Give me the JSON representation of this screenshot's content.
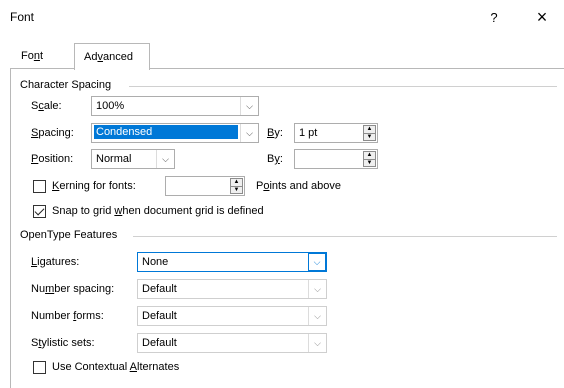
{
  "window": {
    "title": "Font",
    "help": "?",
    "close": "×"
  },
  "tabs": {
    "font": {
      "pre": "Fo",
      "ul": "n",
      "post": "t"
    },
    "advanced": {
      "pre": "Ad",
      "ul": "v",
      "post": "anced"
    }
  },
  "character_spacing": {
    "title": "Character Spacing",
    "scale": {
      "pre": "S",
      "ul": "c",
      "post": "ale:",
      "value": "100%"
    },
    "spacing": {
      "pre": "",
      "ul": "S",
      "post": "pacing:",
      "value": "Condensed"
    },
    "spacing_by": {
      "pre": "",
      "ul": "B",
      "post": "y:",
      "value": "1 pt"
    },
    "position": {
      "pre": "",
      "ul": "P",
      "post": "osition:",
      "value": "Normal"
    },
    "position_by": {
      "pre": "B",
      "ul": "y",
      "post": ":",
      "value": ""
    },
    "kerning": {
      "pre": "",
      "ul": "K",
      "post": "erning for fonts:",
      "value": "",
      "checked": false
    },
    "points_and_above": {
      "pre": "P",
      "ul": "o",
      "post": "ints and above"
    },
    "snap_to_grid": {
      "pre": "Snap to grid ",
      "ul": "w",
      "post": "hen document grid is defined",
      "checked": true
    }
  },
  "opentype": {
    "title": "OpenType Features",
    "ligatures": {
      "pre": "",
      "ul": "L",
      "post": "igatures:",
      "value": "None"
    },
    "number_spacing": {
      "pre": "Nu",
      "ul": "m",
      "post": "ber spacing:",
      "value": "Default"
    },
    "number_forms": {
      "pre": "Number ",
      "ul": "f",
      "post": "orms:",
      "value": "Default"
    },
    "stylistic_sets": {
      "pre": "S",
      "ul": "t",
      "post": "ylistic sets:",
      "value": "Default"
    },
    "contextual_alternates": {
      "pre": "Use Contextual ",
      "ul": "A",
      "post": "lternates",
      "checked": false
    }
  },
  "icons": {
    "dropdown": "chevron-down-icon",
    "spin": "spin-icon",
    "check": "checkmark-icon"
  },
  "colors": {
    "selection": "#0078d7",
    "focus_border": "#0078d7"
  }
}
